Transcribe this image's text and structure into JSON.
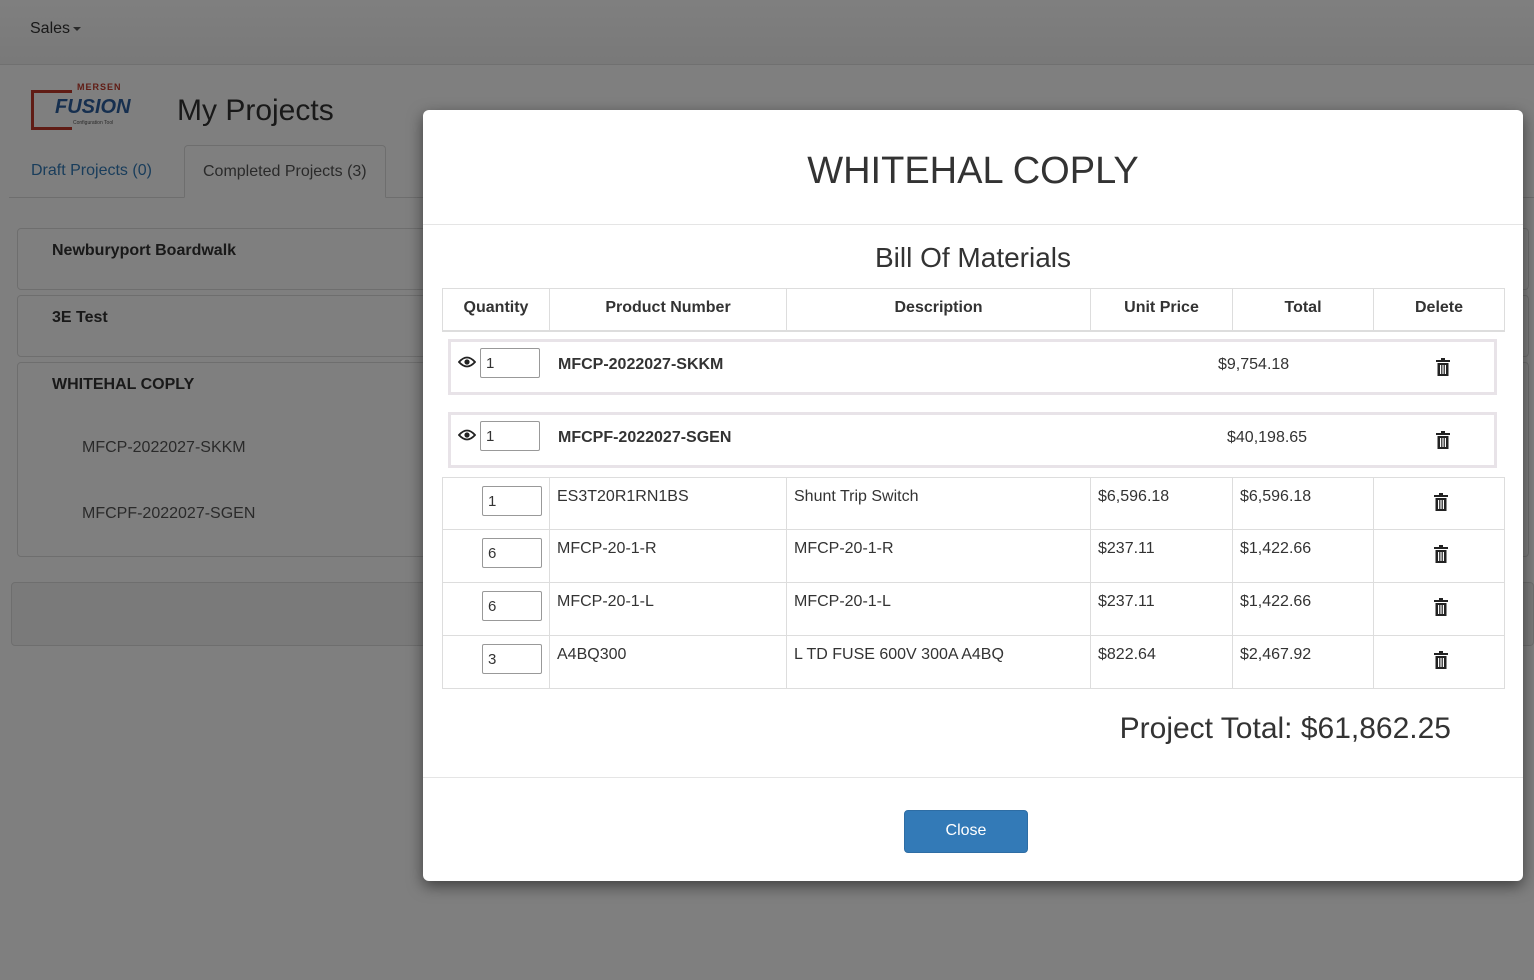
{
  "nav": {
    "menu_label": "Sales"
  },
  "page": {
    "title": "My Projects",
    "logo": {
      "brand": "MERSEN",
      "word": "FUSION",
      "tagline": "Configuration Tool"
    },
    "tabs": [
      {
        "label": "Draft Projects (0)"
      },
      {
        "label": "Completed Projects (3)"
      }
    ],
    "projects": [
      {
        "name": "Newburyport Boardwalk"
      },
      {
        "name": "3E Test"
      },
      {
        "name": "WHITEHAL COPLY",
        "items": [
          "MFCP-2022027-SKKM",
          "MFCPF-2022027-SGEN"
        ]
      }
    ]
  },
  "modal": {
    "title": "WHITEHAL COPLY",
    "bom_title": "Bill Of Materials",
    "columns": [
      "Quantity",
      "Product Number",
      "Description",
      "Unit Price",
      "Total",
      "Delete"
    ],
    "groups": [
      {
        "qty": "1",
        "product": "MFCP-2022027-SKKM",
        "total": "$9,754.18"
      },
      {
        "qty": "1",
        "product": "MFCPF-2022027-SGEN",
        "total": "$40,198.65"
      }
    ],
    "rows": [
      {
        "qty": "1",
        "product": "ES3T20R1RN1BS",
        "description": "Shunt Trip Switch",
        "unit_price": "$6,596.18",
        "total": "$6,596.18"
      },
      {
        "qty": "6",
        "product": "MFCP-20-1-R",
        "description": "MFCP-20-1-R",
        "unit_price": "$237.11",
        "total": "$1,422.66"
      },
      {
        "qty": "6",
        "product": "MFCP-20-1-L",
        "description": "MFCP-20-1-L",
        "unit_price": "$237.11",
        "total": "$1,422.66"
      },
      {
        "qty": "3",
        "product": "A4BQ300",
        "description": "L TD FUSE 600V 300A A4BQ",
        "unit_price": "$822.64",
        "total": "$2,467.92"
      }
    ],
    "project_total": "Project Total: $61,862.25",
    "close_label": "Close"
  },
  "colors": {
    "accent": "#337ab7",
    "overlay": "rgba(0,0,0,0.5)",
    "logo_red": "#c0392b",
    "logo_blue": "#2c5f9e"
  },
  "icons": {
    "eye": "eye-icon",
    "trash": "trash-icon",
    "caret": "caret-down-icon"
  }
}
